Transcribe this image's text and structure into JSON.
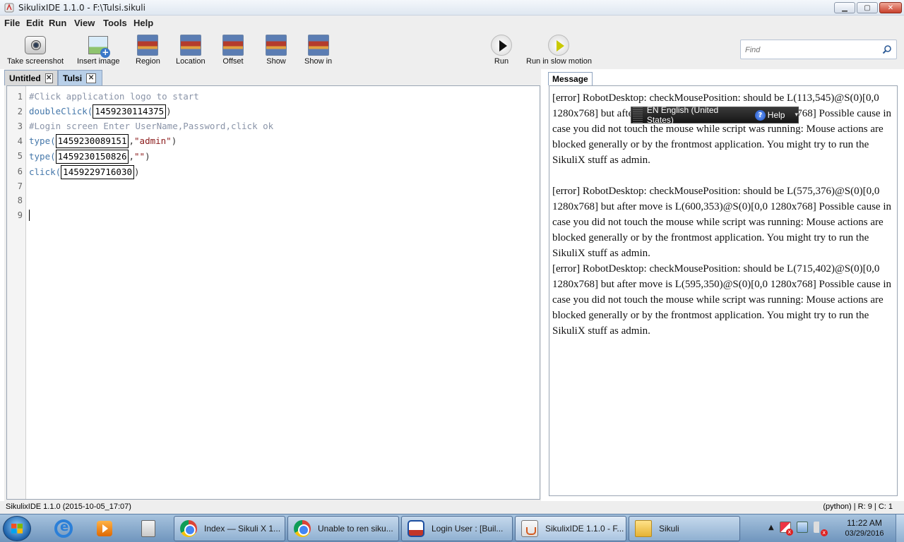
{
  "window": {
    "title": "SikulixIDE 1.1.0 - F:\\Tulsi.sikuli",
    "min": "▁",
    "max": "▢",
    "close": "✕"
  },
  "menu": [
    "File",
    "Edit",
    "Run",
    "View",
    "Tools",
    "Help"
  ],
  "toolbar": {
    "take_screenshot": "Take screenshot",
    "insert_image": "Insert image",
    "region": "Region",
    "location": "Location",
    "offset": "Offset",
    "show": "Show",
    "show_in": "Show in",
    "run": "Run",
    "run_slow": "Run in slow motion"
  },
  "search": {
    "placeholder": "Find"
  },
  "tabs": [
    {
      "label": "Untitled"
    },
    {
      "label": "Tulsi"
    }
  ],
  "tab_close": "✕",
  "editor": {
    "line_numbers": [
      "1",
      "2",
      "3",
      "4",
      "5",
      "6",
      "7",
      "8",
      "9"
    ],
    "lines": [
      {
        "comment": "#Click application logo to start"
      },
      {
        "fn": "doubleClick",
        "open": "(",
        "img": "1459230114375",
        "rest": ")"
      },
      {
        "comment": "#Login screen Enter UserName,Password,click ok"
      },
      {
        "fn": "type",
        "open": "(",
        "img": "1459230089151",
        "rest": ",",
        "str": "\"admin\"",
        "close": ")"
      },
      {
        "fn": "type",
        "open": "(",
        "img": "1459230150826",
        "rest": ",",
        "str": "\"\"",
        "close": ")"
      },
      {
        "fn": "click",
        "open": "(",
        "img": "1459229716030",
        "rest": ")"
      }
    ]
  },
  "message": {
    "tab": "Message",
    "entries": [
      "[error] RobotDesktop: checkMousePosition: should be L(113,545)@S(0)[0,0 1280x768] but after move is L(600,353)@S(0)[0,0 1280x768] Possible cause in case you did not touch the mouse while script was running: Mouse actions are blocked generally or by the frontmost application. You might try to run the SikuliX stuff as admin.",
      "[error] RobotDesktop: checkMousePosition: should be L(575,376)@S(0)[0,0 1280x768] but after move is L(600,353)@S(0)[0,0 1280x768] Possible cause in case you did not touch the mouse while script was running: Mouse actions are blocked generally or by the frontmost application. You might try to run the SikuliX stuff as admin.",
      "[error] RobotDesktop: checkMousePosition: should be L(715,402)@S(0)[0,0 1280x768] but after move is L(595,350)@S(0)[0,0 1280x768] Possible cause in case you did not touch the mouse while script was running: Mouse actions are blocked generally or by the frontmost application. You might try to run the SikuliX stuff as admin."
    ]
  },
  "langbar": {
    "language": "EN English (United States)",
    "help": "Help",
    "help_mark": "?",
    "options": "▾"
  },
  "status": {
    "left": "SikulixIDE 1.1.0 (2015-10-05_17:07)",
    "right": "(python) | R: 9 | C: 1"
  },
  "taskbar": {
    "tasks": [
      {
        "label": "Index — Sikuli X 1...",
        "icon": "chrome-icon"
      },
      {
        "label": "Unable to ren siku...",
        "icon": "chrome-icon"
      },
      {
        "label": "Login User : [Buil...",
        "icon": "login-app-icon"
      },
      {
        "label": "SikulixIDE 1.1.0 - F...",
        "icon": "java-icon"
      },
      {
        "label": "Sikuli",
        "icon": "folder-icon"
      }
    ],
    "tray_arrow": "▲",
    "time": "11:22 AM",
    "date": "03/29/2016"
  }
}
